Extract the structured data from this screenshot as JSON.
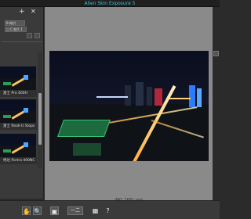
{
  "window": {
    "title": "Alien Skin Exposure 5"
  },
  "sidebar": {
    "add_icon": "+",
    "close_icon": "✕",
    "rows": [
      "Ihi软片",
      "□ C 软片 1"
    ],
    "presets": [
      {
        "label": "富士 Pro 400H"
      },
      {
        "label": "富士 Reali-U Stops"
      },
      {
        "label": "柯达 Portra 400NC"
      }
    ],
    "scroll_position_percent": 40
  },
  "main": {
    "filename": "IMG_1681.psd",
    "photo_description_alt": ""
  },
  "toolbar": {
    "hand_icon": "hand-tool-icon",
    "zoom_icon": "zoom-tool-icon",
    "split_view_label": "一二",
    "layout_icon": "single-view-icon",
    "help_icon": "help-icon"
  },
  "colors": {
    "accent": "#3fc0d0",
    "panel": "#3a3a3a",
    "canvas": "#8a8a8a"
  }
}
